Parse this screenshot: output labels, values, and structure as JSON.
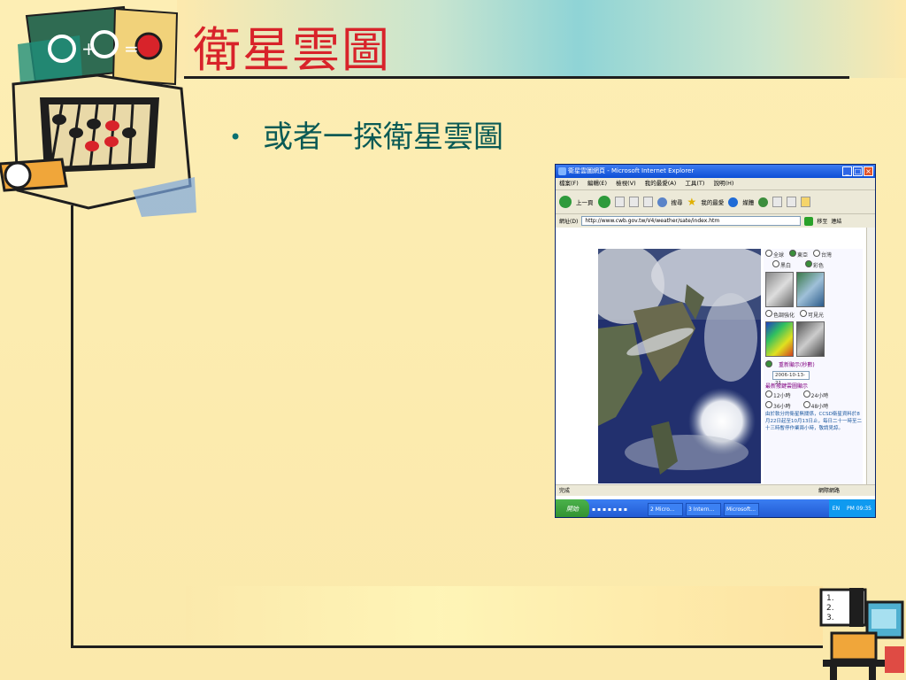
{
  "slide": {
    "title": "衛星雲圖",
    "bullets": [
      "或者一探衛星雲圖"
    ]
  },
  "screenshot": {
    "window_title": "衛星雲圖網頁 - Microsoft Internet Explorer",
    "menu_items": [
      "檔案(F)",
      "編輯(E)",
      "檢視(V)",
      "我的最愛(A)",
      "工具(T)",
      "說明(H)"
    ],
    "toolbar": {
      "back_label": "上一頁",
      "search_label": "搜尋",
      "favorites_label": "我的最愛",
      "media_label": "媒體"
    },
    "address": {
      "label": "網址(D)",
      "url": "http://www.cwb.gov.tw/V4/weather/sate/index.htm",
      "go_label": "移至",
      "links_label": "連結"
    },
    "panel": {
      "region_options": [
        "全球",
        "東亞",
        "台灣"
      ],
      "color_options": [
        "黑白",
        "彩色"
      ],
      "type_options": [
        "色調強化",
        "可見光"
      ],
      "loop_label": "重新顯示(秒數)",
      "date_value": "2006-10-13-21",
      "latest_label": "最新撥鍵雲圖顯示",
      "hour_options": [
        "12小時",
        "24小時",
        "36小時",
        "48小時"
      ],
      "note_text": "由於軟分的衛星無關係，CCSD衛星資料於8月22日起至10月13日止，每日二十一時至二十三時暫停作業兩小時，敬請見諒。"
    },
    "status": {
      "left": "完成",
      "zone": "網際網路"
    },
    "taskbar": {
      "start_label": "開始",
      "tasks": [
        "2 Micro...",
        "3 Intern...",
        "Microsoft..."
      ],
      "tray_lang": "EN",
      "clock": "PM 09:35"
    }
  }
}
